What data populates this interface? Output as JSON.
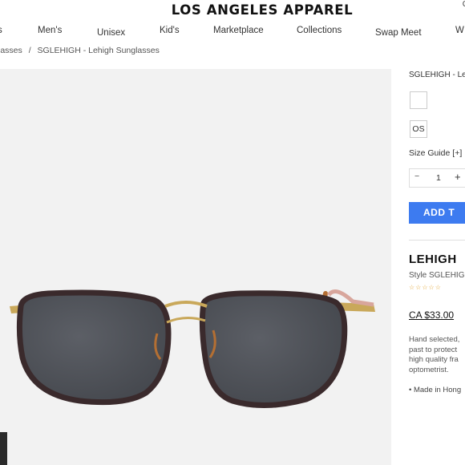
{
  "header": {
    "brand": "LOS ANGELES APPAREL",
    "corner_fragment": "C"
  },
  "nav": {
    "items": [
      "s",
      "Men's",
      "Unisex",
      "Kid's",
      "Marketplace",
      "Collections",
      "Swap Meet",
      "W"
    ]
  },
  "breadcrumb": {
    "parent": "lasses",
    "separator": "/",
    "current": "SGLEHIGH - Lehigh Sunglasses"
  },
  "product": {
    "sku_title": "SGLEHIGH - Le",
    "size_option": "OS",
    "size_guide": "Size Guide [+]",
    "quantity": {
      "minus": "−",
      "value": "1",
      "plus": "+"
    },
    "add_button": "ADD T",
    "name": "LEHIGH",
    "style": "Style SGLEHIGH",
    "stars": "☆☆☆☆☆",
    "price": "CA $33.00",
    "description": [
      "Hand selected,",
      "past to protect",
      "high quality fra",
      "optometrist."
    ],
    "bullet": "• Made in Hong"
  },
  "colors": {
    "accent": "#3d7bf0",
    "image_bg": "#f2f2f2",
    "star": "#e0a02a"
  },
  "icons": [
    "sunglasses-image"
  ]
}
